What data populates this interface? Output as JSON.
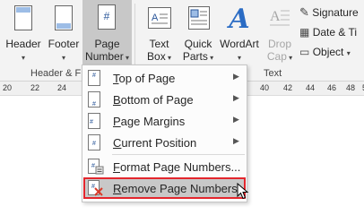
{
  "ribbon": {
    "header_label": "Header",
    "footer_label": "Footer",
    "page_number_label_line1": "Page",
    "page_number_label_line2": "Number",
    "text_box_label_line1": "Text",
    "text_box_label_line2": "Box",
    "quick_parts_label_line1": "Quick",
    "quick_parts_label_line2": "Parts",
    "wordart_label": "WordArt",
    "drop_cap_label_line1": "Drop",
    "drop_cap_label_line2": "Cap",
    "signature_label": "Signature",
    "date_time_label": "Date & Ti",
    "object_label": "Object",
    "group_header_footer": "Header & F",
    "group_text": "Text"
  },
  "ruler": {
    "left_ticks": [
      "20",
      "22",
      "24"
    ],
    "right_ticks": [
      "40",
      "42",
      "44",
      "46",
      "48",
      "50"
    ]
  },
  "page_number_menu": {
    "items": [
      {
        "label": "Top of Page",
        "access_key": "T",
        "rest": "op of Page",
        "has_submenu": true
      },
      {
        "label": "Bottom of Page",
        "access_key": "B",
        "rest": "ottom of Page",
        "has_submenu": true
      },
      {
        "label": "Page Margins",
        "access_key": "P",
        "rest": "age Margins",
        "has_submenu": true
      },
      {
        "label": "Current Position",
        "access_key": "C",
        "rest": "urrent Position",
        "has_submenu": true
      },
      {
        "label": "Format Page Numbers...",
        "access_key": "F",
        "rest": "ormat Page Numbers...",
        "has_submenu": false
      },
      {
        "label": "Remove Page Numbers",
        "access_key": "R",
        "rest": "emove Page Numbers",
        "has_submenu": false,
        "highlighted": true
      }
    ]
  },
  "colors": {
    "highlight_outline": "#e3262d",
    "wordart_blue": "#2b6cc4",
    "selected_bg": "#c8c8c8"
  }
}
